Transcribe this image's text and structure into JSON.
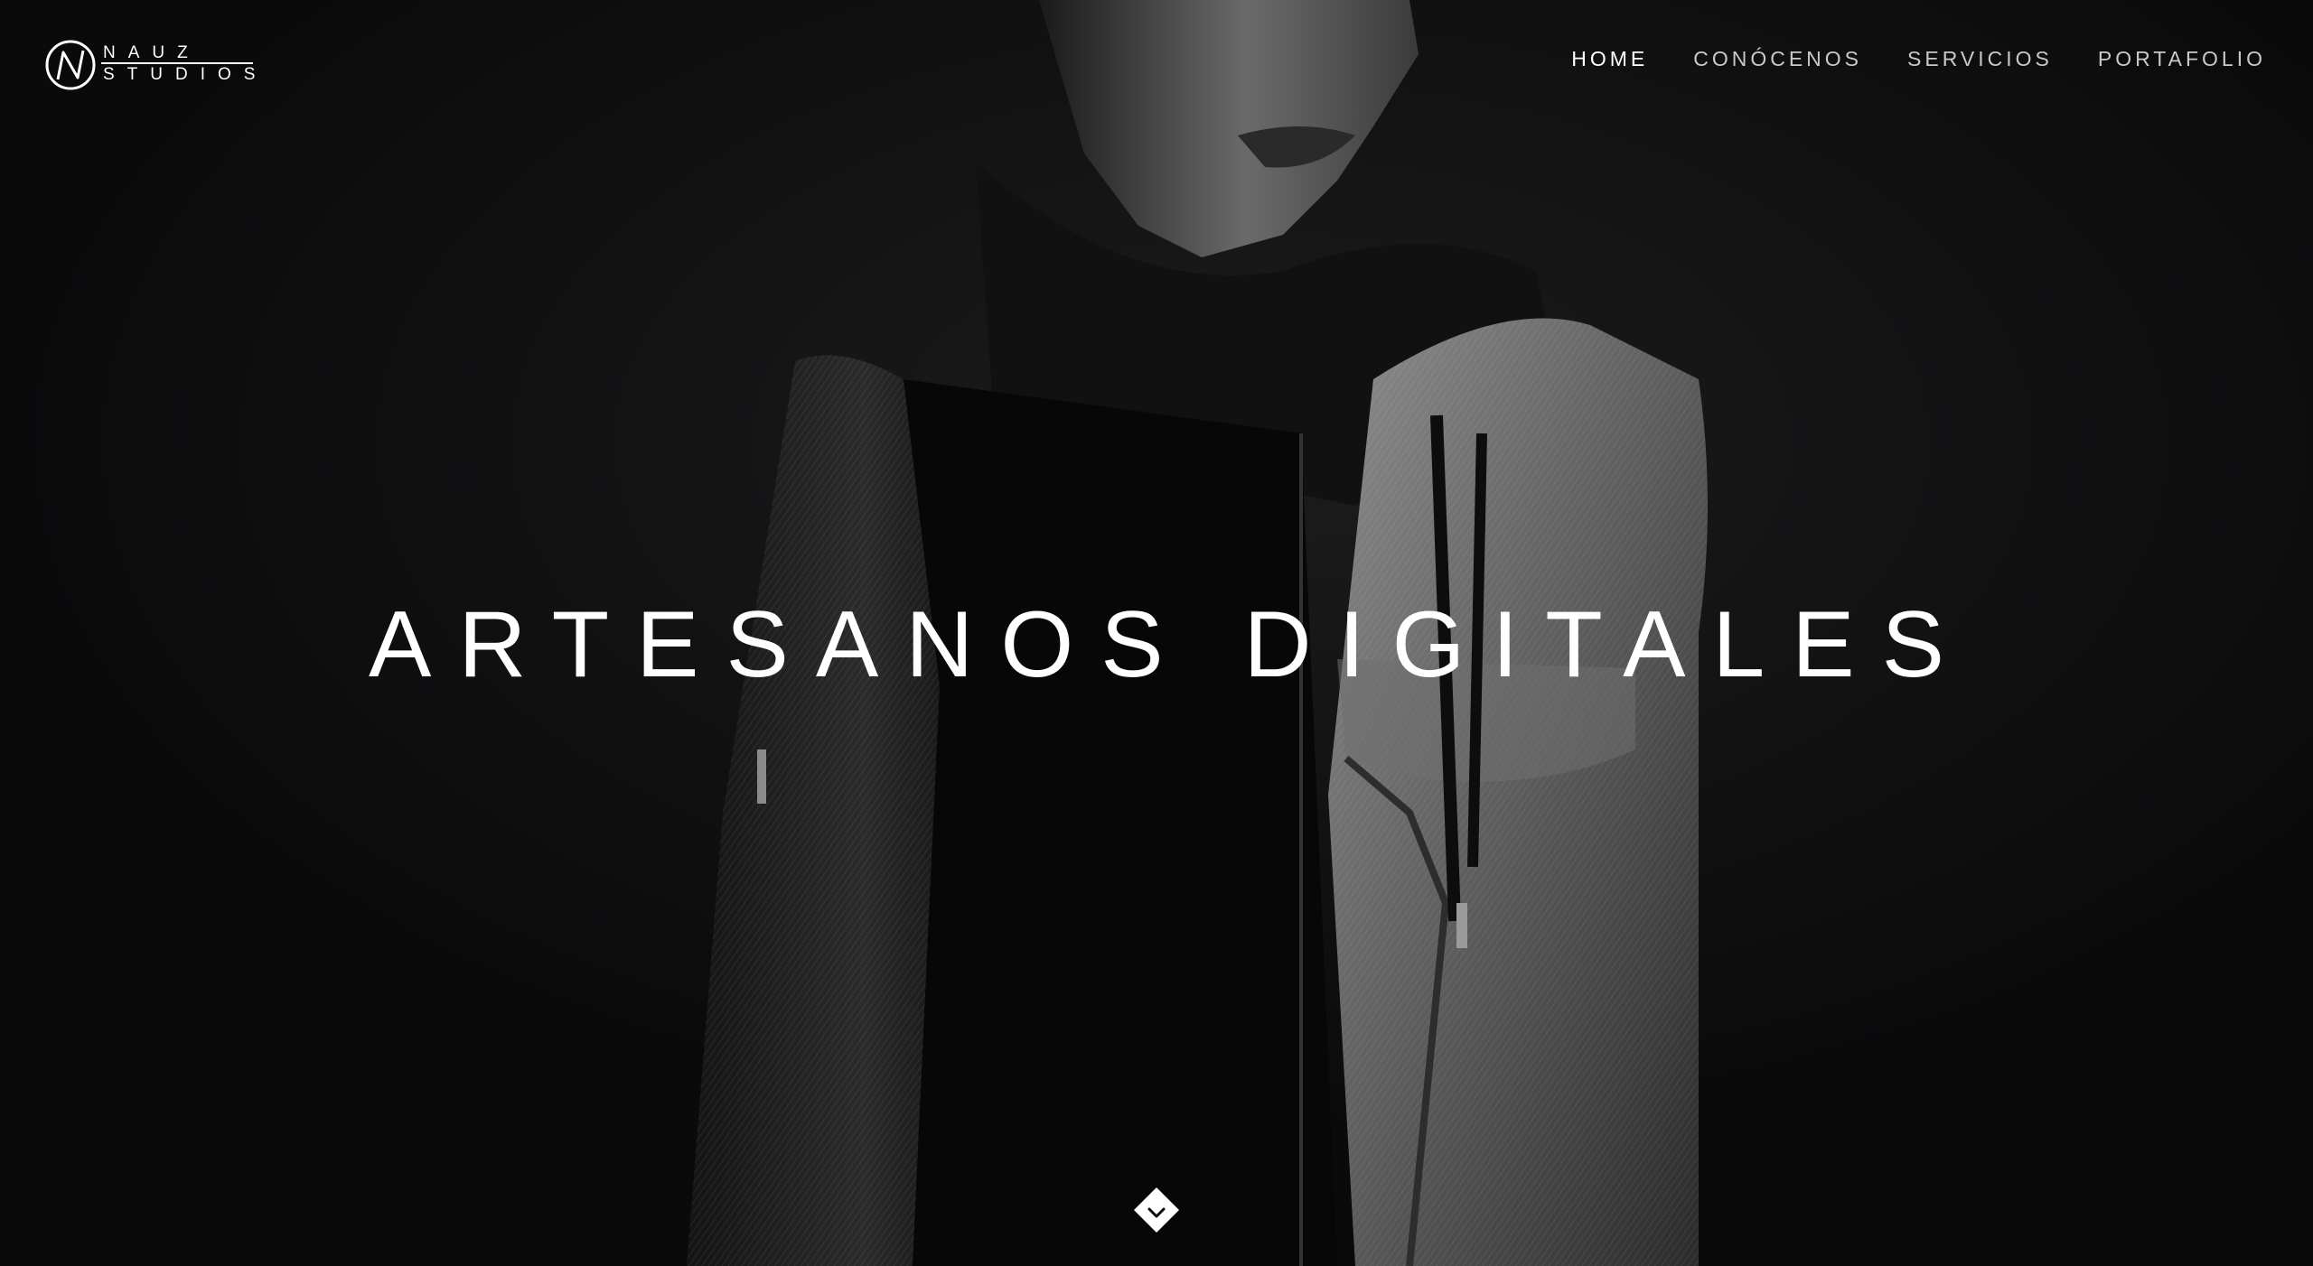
{
  "brand": {
    "line1": "NAUZ",
    "line2": "STUDIOS",
    "logo_icon": "n-circle-icon"
  },
  "nav": {
    "items": [
      {
        "label": "HOME",
        "active": true
      },
      {
        "label": "CONÓCENOS",
        "active": false
      },
      {
        "label": "SERVICIOS",
        "active": false
      },
      {
        "label": "PORTAFOLIO",
        "active": false
      }
    ]
  },
  "hero": {
    "headline": "ARTESANOS DIGITALES",
    "background_icon": "man-denim-jacket-photo",
    "scroll_icon": "chevron-down-diamond-icon"
  },
  "colors": {
    "background": "#0a0a0b",
    "text": "#ffffff",
    "nav_text": "#c9c9c9"
  }
}
